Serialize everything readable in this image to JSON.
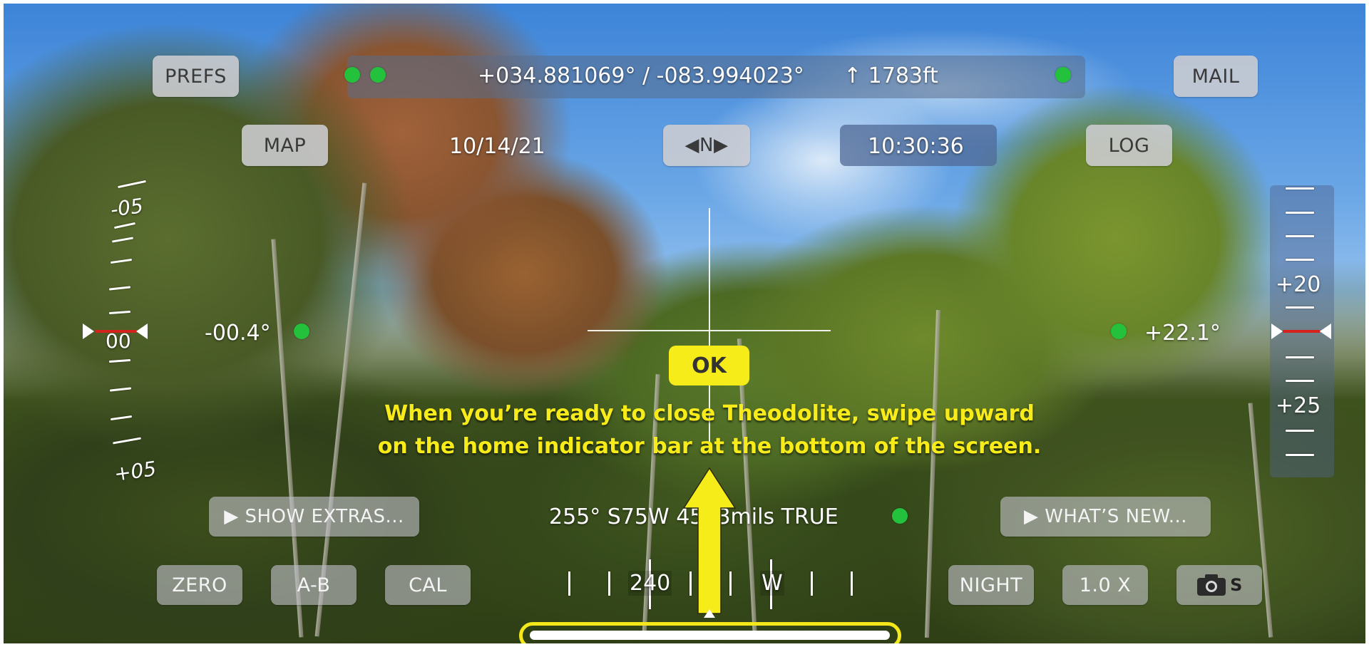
{
  "top": {
    "prefs_label": "PREFS",
    "mail_label": "MAIL",
    "coordinates": "+034.881069° / -083.994023°",
    "elevation": "↑ 1783ft",
    "map_label": "MAP",
    "date": "10/14/21",
    "heading_toggle": "◀N▶",
    "time": "10:30:36",
    "log_label": "LOG"
  },
  "left_scale": {
    "upper_label": "-05",
    "center_label": "00",
    "lower_label": "+05",
    "reading": "-00.4°"
  },
  "right_scale": {
    "upper_label": "+20",
    "lower_label": "+25",
    "reading": "+22.1°"
  },
  "center": {
    "ok_label": "OK",
    "instruction_line1": "When you’re ready to close Theodolite, swipe upward",
    "instruction_line2": "on the home indicator bar at the bottom of the screen."
  },
  "bearing": {
    "text": "255° S75W 4533mils TRUE"
  },
  "buttons": {
    "show_extras": "▶ SHOW EXTRAS...",
    "whats_new": "▶ WHAT’S NEW...",
    "zero": "ZERO",
    "a_b": "A-B",
    "cal": "CAL",
    "night": "NIGHT",
    "zoom": "1.0 X",
    "camera_suffix": "S"
  },
  "compass": {
    "label_240": "240",
    "label_w": "W"
  },
  "colors": {
    "highlight_yellow": "#f6ec19",
    "status_green": "#24c23c",
    "level_red": "#d4231d"
  }
}
